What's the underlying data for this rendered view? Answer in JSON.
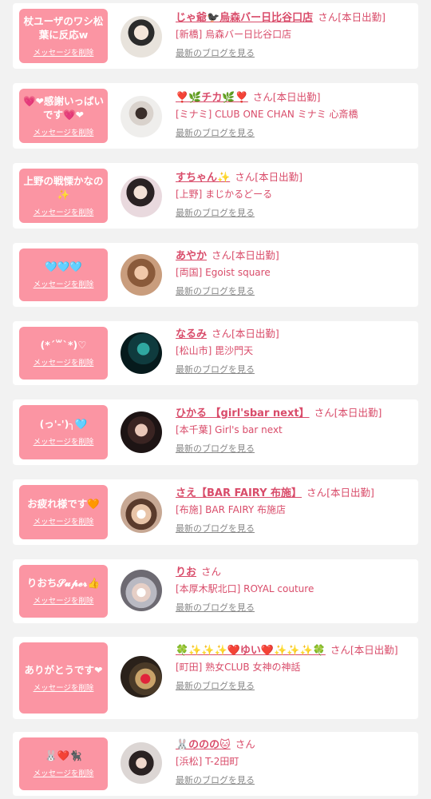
{
  "delete_label": "メッセージを削除",
  "blog_label": "最新のブログを見る",
  "san_label": "さん",
  "entries": [
    {
      "message": "杖ユーザのワシ松葉に反応w",
      "name": "じゃ爺🐦‍⬛烏森バー日比谷口店",
      "status": "[本日出勤]",
      "shop": "[新橋] 烏森バー日比谷口店",
      "avatar_icon": "avatar-photo"
    },
    {
      "message": "💗❤感謝いっぱいです💗❤",
      "name": "❣️🌿チカ🌿❣️",
      "status": "[本日出勤]",
      "shop": "[ミナミ] CLUB ONE CHAN ミナミ 心斎橋",
      "avatar_icon": "avatar-photo"
    },
    {
      "message": "上野の戦慄かなの✨",
      "name": "すちゃん✨",
      "status": "[本日出勤]",
      "shop": "[上野] まじかるどーる",
      "avatar_icon": "avatar-photo"
    },
    {
      "message": "🩵🩵🩵",
      "name": "あやか",
      "status": "[本日出勤]",
      "shop": "[両国] Egoist square",
      "avatar_icon": "avatar-photo"
    },
    {
      "message": "(*´꒳`*)♡",
      "name": "なるみ",
      "status": "[本日出勤]",
      "shop": "[松山市] 毘沙門天",
      "avatar_icon": "avatar-photo"
    },
    {
      "message": "(っ'-')╮🩵",
      "name": "ひかる 【girl'sbar next】",
      "status": "[本日出勤]",
      "shop": "[本千葉] Girl's bar next",
      "avatar_icon": "avatar-photo"
    },
    {
      "message": "お疲れ様です🧡",
      "name": "さえ【BAR FAIRY 布施】",
      "status": "[本日出勤]",
      "shop": "[布施] BAR FAIRY 布施店",
      "avatar_icon": "avatar-photo"
    },
    {
      "message": "りおち𝓢𝓾𝓹𝓮𝓻👍",
      "name": "りお",
      "status": "",
      "shop": "[本厚木駅北口] ROYAL couture",
      "avatar_icon": "avatar-photo"
    },
    {
      "message": "ありがとうです❤",
      "name": "🍀✨✨✨❤️ゆい❤️✨✨✨🍀",
      "status": "[本日出勤]",
      "shop": "[町田] 熟女CLUB 女神の神話",
      "avatar_icon": "avatar-photo"
    },
    {
      "message": "🐰❤️🐈‍⬛",
      "name": "🐰ののの🐱",
      "status": "",
      "shop": "[浜松] T-2田町",
      "avatar_icon": "avatar-photo"
    }
  ],
  "colors": {
    "bubble": "#fb95a3",
    "link": "#d94c6a",
    "background": "#f2f2f2"
  }
}
